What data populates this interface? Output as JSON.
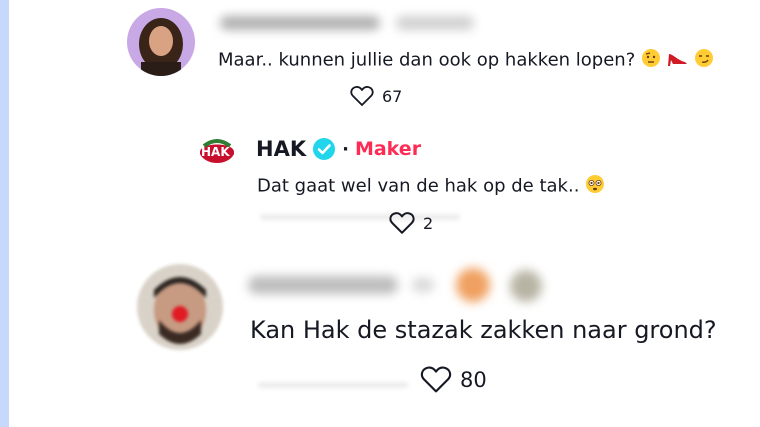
{
  "comments": [
    {
      "text": "Maar.. kunnen jullie dan ook op hakken lopen?",
      "likes": "67"
    },
    {
      "username": "HAK",
      "badge": "Maker",
      "text": "Dat gaat wel van de hak op de tak..",
      "likes": "2",
      "logo_text": "HAK"
    },
    {
      "text": "Kan Hak de stazak zakken naar grond?",
      "likes": "80"
    }
  ],
  "colors": {
    "maker_badge": "#fe2c55",
    "verified": "#20d5ec",
    "sidebar": "#c6d8fb"
  }
}
